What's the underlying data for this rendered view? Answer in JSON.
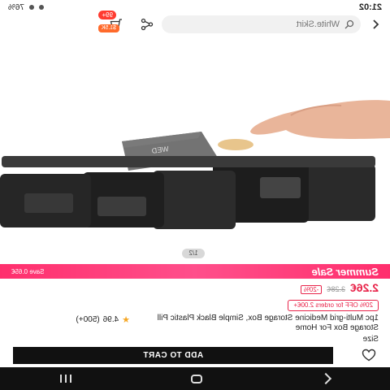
{
  "status_bar": {
    "time": "21:02",
    "battery": "76%"
  },
  "search": {
    "placeholder": "White.Skirt"
  },
  "cart": {
    "count": "99+",
    "promo": "$1.5K"
  },
  "gallery": {
    "counter": "1/2"
  },
  "sale": {
    "title": "Summer Sale",
    "save": "Save 0.65€"
  },
  "price": {
    "current": "2.26€",
    "original": "3.28€",
    "discount": "-20%"
  },
  "coupon": {
    "text": "20% OFF for orders 2.00€+"
  },
  "product": {
    "title": "1pc Multi-grid Medicine Storage Box, Simple Black Plastic Pill Storage Box For Home",
    "rating": "4.96",
    "reviews": "(500+)"
  },
  "size_label": "Size",
  "actions": {
    "add_to_cart": "ADD TO CART"
  },
  "icons": {
    "back": "back-arrow-icon",
    "search": "search-icon",
    "share": "share-icon",
    "cart": "cart-icon",
    "wishlist": "heart-icon",
    "star": "star-icon"
  },
  "colors": {
    "sale": "#ff2f6d",
    "price": "#e8244a",
    "button": "#111111",
    "star": "#f5a623"
  }
}
